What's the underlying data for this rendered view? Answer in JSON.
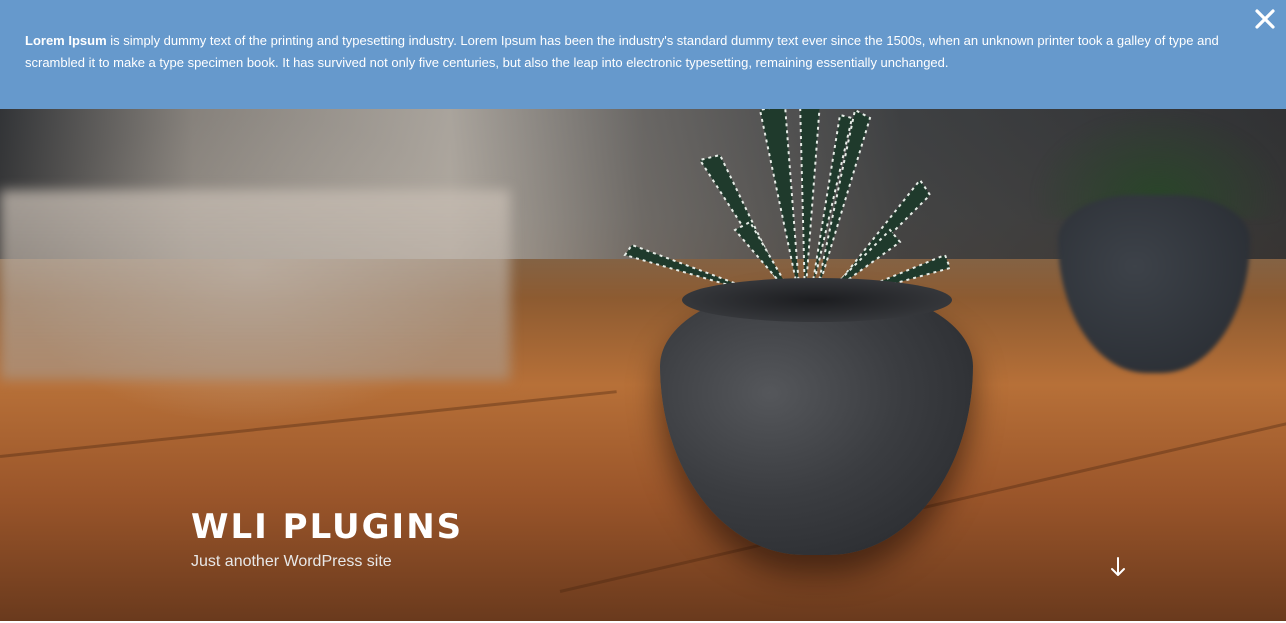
{
  "banner": {
    "bold_lead": "Lorem Ipsum",
    "text": " is simply dummy text of the printing and typesetting industry. Lorem Ipsum has been the industry's standard dummy text ever since the 1500s, when an unknown printer took a galley of type and scrambled it to make a type specimen book. It has survived not only five centuries, but also the leap into electronic typesetting, remaining essentially unchanged.",
    "background_color": "#6699cc",
    "close_icon": "close-icon"
  },
  "site": {
    "title": "WLI PLUGINS",
    "description": "Just another WordPress site"
  },
  "hero": {
    "image": "potted-succulent-on-wooden-table",
    "scroll_icon": "arrow-down-icon"
  }
}
